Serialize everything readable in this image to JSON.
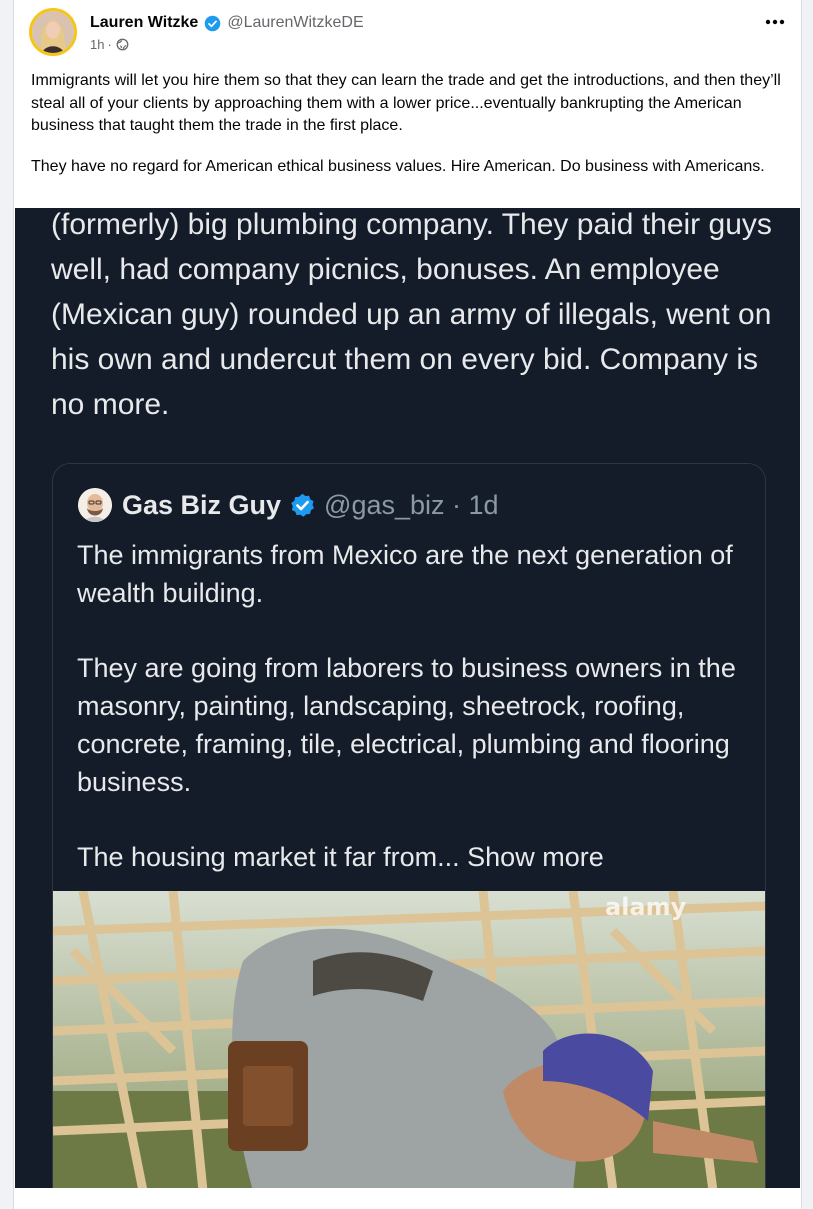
{
  "post": {
    "author_name": "Lauren Witzke",
    "author_handle": "@LaurenWitzkeDE",
    "time": "1h",
    "meta_separator": "·",
    "visibility_icon": "globe-icon",
    "more_icon": "ellipsis-icon",
    "paragraphs": [
      "Immigrants will let you hire them so that they can learn the trade and get the introductions, and then they’ll steal all of your clients by approaching them with a lower price...eventually bankrupting the American business that taught them the trade in the first place.",
      "They have no regard for American ethical business values. Hire American. Do business with Americans."
    ]
  },
  "screenshot": {
    "reply_text": "(formerly) big plumbing company. They paid their guys well, had company picnics, bonuses. An employee (Mexican guy) rounded up an army of illegals, went on his own and undercut them on every bid. Company is no more.",
    "quote": {
      "name": "Gas Biz Guy",
      "handle_time": "@gas_biz · 1d",
      "paragraphs": [
        "The immigrants from Mexico are the next generation of wealth building.",
        "They are going from laborers to business owners in the masonry, painting, landscaping, sheetrock, roofing, concrete, framing, tile, electrical, plumbing and flooring business."
      ],
      "last_line": "The housing market it far from...",
      "show_more": "Show more",
      "photo_watermark": "alamy"
    }
  },
  "colors": {
    "verified_blue": "#1d9bf0",
    "dark_bg": "#141b29",
    "text_primary": "#050505",
    "text_secondary": "#65676b"
  }
}
